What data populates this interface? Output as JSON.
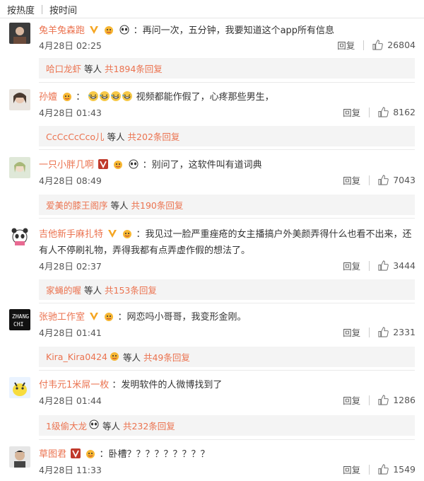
{
  "tabs": [
    "按热度",
    "按时间"
  ],
  "comments": [
    {
      "user": "兔羊兔森跑",
      "text": "：再问一次，五分钟，我要知道这个app所有信息",
      "date": "4月28日",
      "time": "02:25",
      "reply": "回复",
      "likes": "26804",
      "sub": {
        "user": "哈口龙虾",
        "mid": "等人",
        "total": "共1894条回复"
      }
    },
    {
      "user": "孙嬗",
      "text": "视频都能作假了，心疼那些男生，",
      "date": "4月28日",
      "time": "01:43",
      "reply": "回复",
      "likes": "8162",
      "sub": {
        "user": "CcCcCcCco儿",
        "mid": "等人",
        "total": "共202条回复"
      }
    },
    {
      "user": "一只小胖几啊",
      "text": "：别问了，这软件叫有道词典",
      "date": "4月28日",
      "time": "08:49",
      "reply": "回复",
      "likes": "7043",
      "sub": {
        "user": "爱美的膝王阁序",
        "mid": "等人",
        "total": "共190条回复"
      }
    },
    {
      "user": "吉他新手麻扎特",
      "text": "：我见过一脸严重痤疮的女主播搞户外美颜弄得什么也看不出来，还有人不停刷礼物，弄得我都有点弄虚作假的想法了。",
      "date": "4月28日",
      "time": "02:37",
      "reply": "回复",
      "likes": "3444",
      "sub": {
        "user": "家蝇的喔",
        "mid": "等人",
        "total": "共153条回复"
      }
    },
    {
      "user": "张驰工作室",
      "text": "：网恋吗小哥哥，我变形金刚。",
      "date": "4月28日",
      "time": "01:41",
      "reply": "回复",
      "likes": "2331",
      "sub": {
        "user": "Kira_Kira0424",
        "mid": "等人",
        "total": "共49条回复"
      }
    },
    {
      "user": "付韦元1米屌一枚",
      "text": "：发明软件的人微博找到了",
      "date": "4月28日",
      "time": "01:44",
      "reply": "回复",
      "likes": "1286",
      "sub": {
        "user": "1级偷大龙",
        "mid": "等人",
        "total": "共232条回复"
      }
    },
    {
      "user": "草图君",
      "text": "：卧槽？？？？？？？？？",
      "date": "4月28日",
      "time": "11:33",
      "reply": "回复",
      "likes": "1549"
    }
  ],
  "colors": {
    "username": "#eb7350",
    "subbox_bg": "#f4f4f4",
    "text": "#333333",
    "vip_badge": "#f5a623"
  },
  "icons": [
    "avatar",
    "vip-v-badge",
    "crown-badge",
    "panda-emoji",
    "laughing-emoji",
    "thumbs-up-icon"
  ]
}
